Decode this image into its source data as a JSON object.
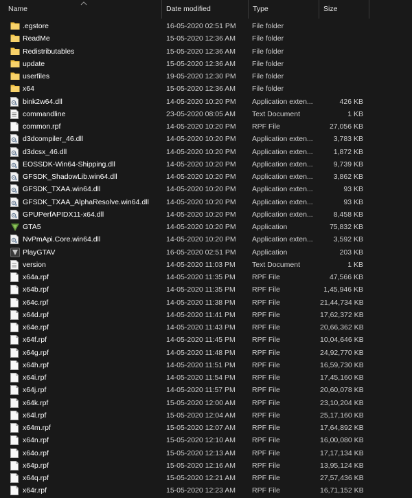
{
  "header": {
    "name": "Name",
    "date": "Date modified",
    "type": "Type",
    "size": "Size"
  },
  "colors": {
    "folder": "#f4c444",
    "background": "#191919"
  },
  "files": [
    {
      "name": ".egstore",
      "date": "16-05-2020 02:51 PM",
      "type": "File folder",
      "size": "",
      "icon": "folder-icon"
    },
    {
      "name": "ReadMe",
      "date": "15-05-2020 12:36 AM",
      "type": "File folder",
      "size": "",
      "icon": "folder-icon"
    },
    {
      "name": "Redistributables",
      "date": "15-05-2020 12:36 AM",
      "type": "File folder",
      "size": "",
      "icon": "folder-icon"
    },
    {
      "name": "update",
      "date": "15-05-2020 12:36 AM",
      "type": "File folder",
      "size": "",
      "icon": "folder-icon"
    },
    {
      "name": "userfiles",
      "date": "19-05-2020 12:30 PM",
      "type": "File folder",
      "size": "",
      "icon": "folder-icon"
    },
    {
      "name": "x64",
      "date": "15-05-2020 12:36 AM",
      "type": "File folder",
      "size": "",
      "icon": "folder-icon"
    },
    {
      "name": "bink2w64.dll",
      "date": "14-05-2020 10:20 PM",
      "type": "Application exten...",
      "size": "426 KB",
      "icon": "dll-file-icon"
    },
    {
      "name": "commandline",
      "date": "23-05-2020 08:05 AM",
      "type": "Text Document",
      "size": "1 KB",
      "icon": "text-file-icon"
    },
    {
      "name": "common.rpf",
      "date": "14-05-2020 10:20 PM",
      "type": "RPF File",
      "size": "27,056 KB",
      "icon": "blank-file-icon"
    },
    {
      "name": "d3dcompiler_46.dll",
      "date": "14-05-2020 10:20 PM",
      "type": "Application exten...",
      "size": "3,783 KB",
      "icon": "dll-file-icon"
    },
    {
      "name": "d3dcsx_46.dll",
      "date": "14-05-2020 10:20 PM",
      "type": "Application exten...",
      "size": "1,872 KB",
      "icon": "dll-file-icon"
    },
    {
      "name": "EOSSDK-Win64-Shipping.dll",
      "date": "14-05-2020 10:20 PM",
      "type": "Application exten...",
      "size": "9,739 KB",
      "icon": "dll-file-icon"
    },
    {
      "name": "GFSDK_ShadowLib.win64.dll",
      "date": "14-05-2020 10:20 PM",
      "type": "Application exten...",
      "size": "3,862 KB",
      "icon": "dll-file-icon"
    },
    {
      "name": "GFSDK_TXAA.win64.dll",
      "date": "14-05-2020 10:20 PM",
      "type": "Application exten...",
      "size": "93 KB",
      "icon": "dll-file-icon"
    },
    {
      "name": "GFSDK_TXAA_AlphaResolve.win64.dll",
      "date": "14-05-2020 10:20 PM",
      "type": "Application exten...",
      "size": "93 KB",
      "icon": "dll-file-icon"
    },
    {
      "name": "GPUPerfAPIDX11-x64.dll",
      "date": "14-05-2020 10:20 PM",
      "type": "Application exten...",
      "size": "8,458 KB",
      "icon": "dll-file-icon"
    },
    {
      "name": "GTA5",
      "date": "14-05-2020 10:20 PM",
      "type": "Application",
      "size": "75,832 KB",
      "icon": "gta5-app-icon"
    },
    {
      "name": "NvPmApi.Core.win64.dll",
      "date": "14-05-2020 10:20 PM",
      "type": "Application exten...",
      "size": "3,592 KB",
      "icon": "dll-file-icon"
    },
    {
      "name": "PlayGTAV",
      "date": "16-05-2020 02:51 PM",
      "type": "Application",
      "size": "203 KB",
      "icon": "playgtav-app-icon"
    },
    {
      "name": "version",
      "date": "14-05-2020 11:03 PM",
      "type": "Text Document",
      "size": "1 KB",
      "icon": "text-file-icon"
    },
    {
      "name": "x64a.rpf",
      "date": "14-05-2020 11:35 PM",
      "type": "RPF File",
      "size": "47,566 KB",
      "icon": "blank-file-icon"
    },
    {
      "name": "x64b.rpf",
      "date": "14-05-2020 11:35 PM",
      "type": "RPF File",
      "size": "1,45,946 KB",
      "icon": "blank-file-icon"
    },
    {
      "name": "x64c.rpf",
      "date": "14-05-2020 11:38 PM",
      "type": "RPF File",
      "size": "21,44,734 KB",
      "icon": "blank-file-icon"
    },
    {
      "name": "x64d.rpf",
      "date": "14-05-2020 11:41 PM",
      "type": "RPF File",
      "size": "17,62,372 KB",
      "icon": "blank-file-icon"
    },
    {
      "name": "x64e.rpf",
      "date": "14-05-2020 11:43 PM",
      "type": "RPF File",
      "size": "20,66,362 KB",
      "icon": "blank-file-icon"
    },
    {
      "name": "x64f.rpf",
      "date": "14-05-2020 11:45 PM",
      "type": "RPF File",
      "size": "10,04,646 KB",
      "icon": "blank-file-icon"
    },
    {
      "name": "x64g.rpf",
      "date": "14-05-2020 11:48 PM",
      "type": "RPF File",
      "size": "24,92,770 KB",
      "icon": "blank-file-icon"
    },
    {
      "name": "x64h.rpf",
      "date": "14-05-2020 11:51 PM",
      "type": "RPF File",
      "size": "16,59,730 KB",
      "icon": "blank-file-icon"
    },
    {
      "name": "x64i.rpf",
      "date": "14-05-2020 11:54 PM",
      "type": "RPF File",
      "size": "17,45,160 KB",
      "icon": "blank-file-icon"
    },
    {
      "name": "x64j.rpf",
      "date": "14-05-2020 11:57 PM",
      "type": "RPF File",
      "size": "20,60,078 KB",
      "icon": "blank-file-icon"
    },
    {
      "name": "x64k.rpf",
      "date": "15-05-2020 12:00 AM",
      "type": "RPF File",
      "size": "23,10,204 KB",
      "icon": "blank-file-icon"
    },
    {
      "name": "x64l.rpf",
      "date": "15-05-2020 12:04 AM",
      "type": "RPF File",
      "size": "25,17,160 KB",
      "icon": "blank-file-icon"
    },
    {
      "name": "x64m.rpf",
      "date": "15-05-2020 12:07 AM",
      "type": "RPF File",
      "size": "17,64,892 KB",
      "icon": "blank-file-icon"
    },
    {
      "name": "x64n.rpf",
      "date": "15-05-2020 12:10 AM",
      "type": "RPF File",
      "size": "16,00,080 KB",
      "icon": "blank-file-icon"
    },
    {
      "name": "x64o.rpf",
      "date": "15-05-2020 12:13 AM",
      "type": "RPF File",
      "size": "17,17,134 KB",
      "icon": "blank-file-icon"
    },
    {
      "name": "x64p.rpf",
      "date": "15-05-2020 12:16 AM",
      "type": "RPF File",
      "size": "13,95,124 KB",
      "icon": "blank-file-icon"
    },
    {
      "name": "x64q.rpf",
      "date": "15-05-2020 12:21 AM",
      "type": "RPF File",
      "size": "27,57,436 KB",
      "icon": "blank-file-icon"
    },
    {
      "name": "x64r.rpf",
      "date": "15-05-2020 12:23 AM",
      "type": "RPF File",
      "size": "16,71,152 KB",
      "icon": "blank-file-icon"
    }
  ]
}
